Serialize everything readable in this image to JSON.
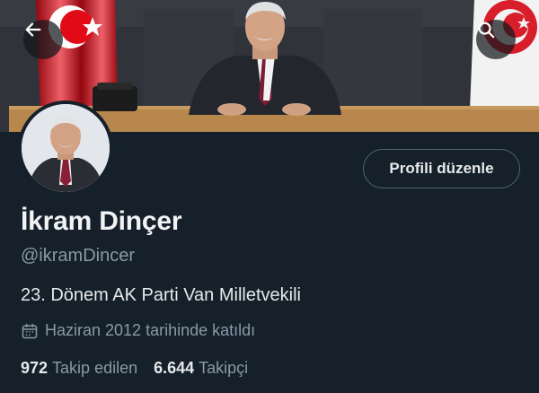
{
  "header": {
    "back_icon": "arrow-left-icon",
    "search_icon": "search-icon"
  },
  "profile": {
    "name": "İkram Dinçer",
    "handle": "@ikramDincer",
    "bio": "23. Dönem AK Parti Van Milletvekili",
    "joined_icon": "calendar-icon",
    "joined": "Haziran 2012 tarihinde katıldı",
    "edit_button_label": "Profili düzenle",
    "following_count": "972",
    "following_label": "Takip edilen",
    "followers_count": "6.644",
    "followers_label": "Takipçi"
  },
  "colors": {
    "background": "#15202b",
    "primary_text": "#e7e9ea",
    "secondary_text": "#8b98a5",
    "button_border": "#536471",
    "flag_red": "#e30a17"
  }
}
